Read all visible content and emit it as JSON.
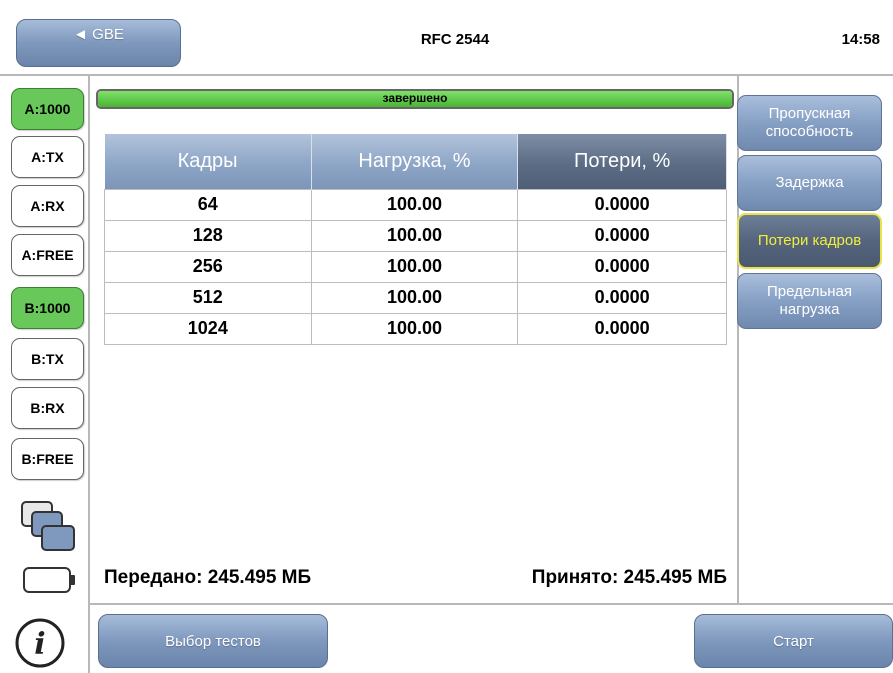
{
  "header": {
    "back_label": "◄ GBE",
    "title": "RFC 2544",
    "time": "14:58"
  },
  "sidebar": {
    "ports": [
      {
        "label": "A:1000",
        "active": true
      },
      {
        "label": "A:TX",
        "active": false
      },
      {
        "label": "A:RX",
        "active": false
      },
      {
        "label": "A:FREE",
        "active": false
      },
      {
        "label": "B:1000",
        "active": true
      },
      {
        "label": "B:TX",
        "active": false
      },
      {
        "label": "B:RX",
        "active": false
      },
      {
        "label": "B:FREE",
        "active": false
      }
    ],
    "icons": [
      "window-stack-icon",
      "battery-icon",
      "info-icon"
    ]
  },
  "progress": {
    "label": "завершено",
    "fraction": 1.0,
    "color": "#5cc447"
  },
  "table": {
    "headers": [
      "Кадры",
      "Нагрузка, %",
      "Потери, %"
    ],
    "rows": [
      [
        "64",
        "100.00",
        "0.0000"
      ],
      [
        "128",
        "100.00",
        "0.0000"
      ],
      [
        "256",
        "100.00",
        "0.0000"
      ],
      [
        "512",
        "100.00",
        "0.0000"
      ],
      [
        "1024",
        "100.00",
        "0.0000"
      ]
    ]
  },
  "totals": {
    "sent": "Передано: 245.495 МБ",
    "received": "Принято: 245.495 МБ"
  },
  "tabs": [
    {
      "label": "Пропускная способность",
      "active": false
    },
    {
      "label": "Задержка",
      "active": false
    },
    {
      "label": "Потери кадров",
      "active": true
    },
    {
      "label": "Предельная нагрузка",
      "active": false
    }
  ],
  "footer": {
    "select_tests_label": "Выбор тестов",
    "start_label": "Старт"
  },
  "colors": {
    "button_blue": "#7f98bd",
    "active_green": "#68c85a",
    "active_tab_text": "#f3ee3a"
  }
}
